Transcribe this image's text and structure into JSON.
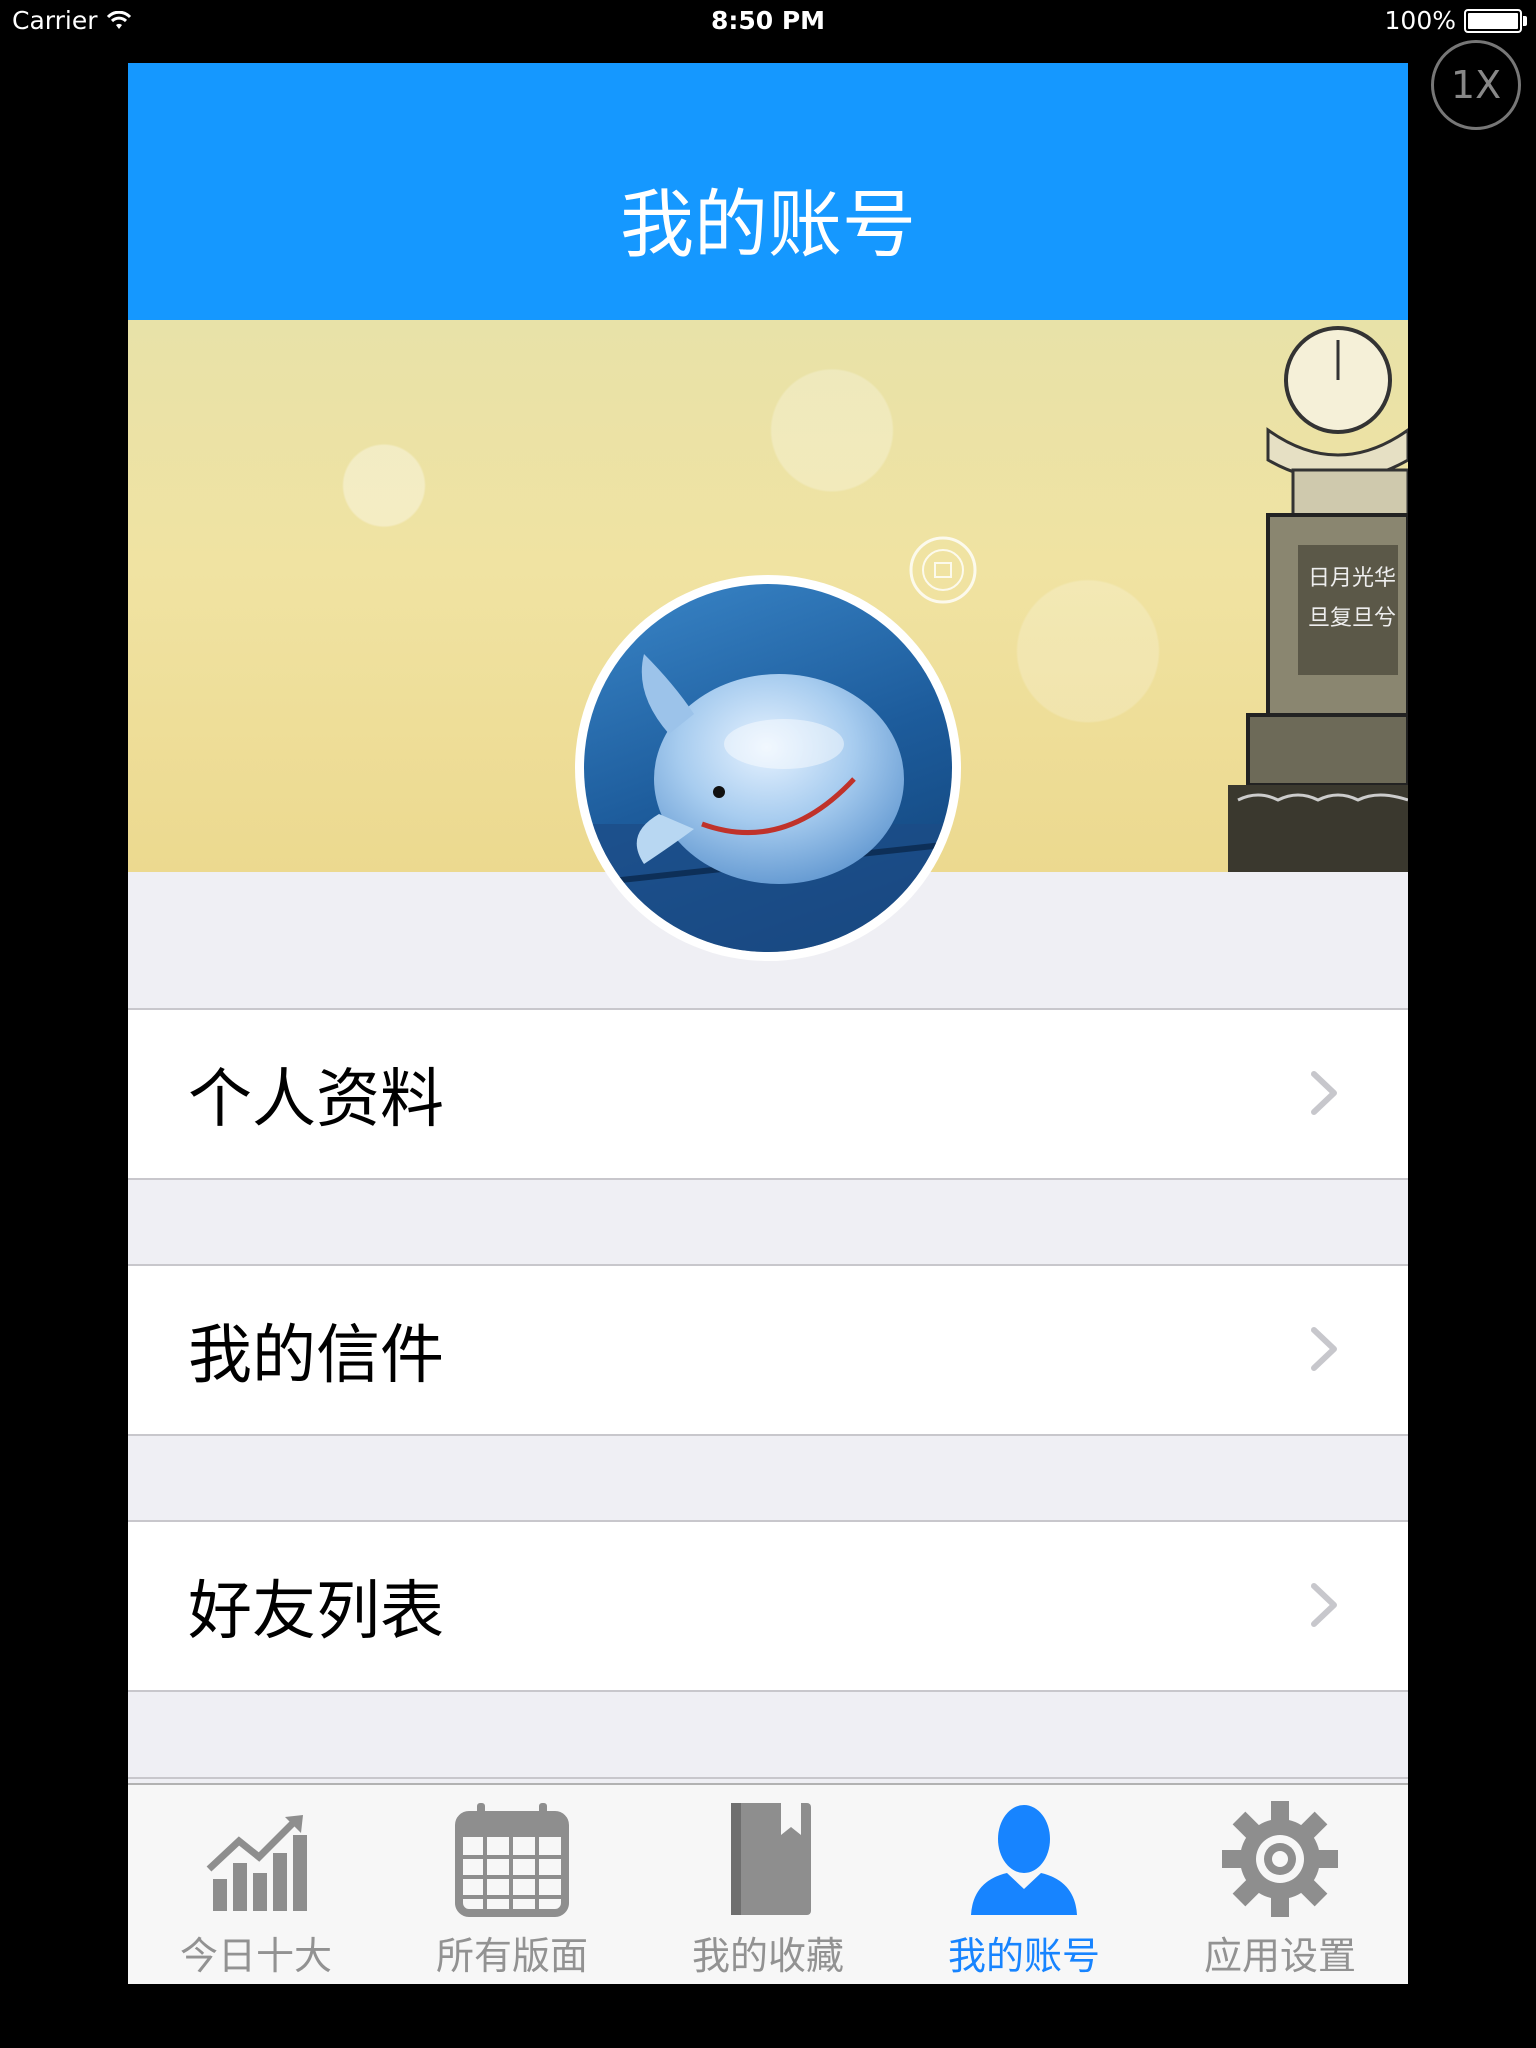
{
  "status_bar": {
    "carrier": "Carrier",
    "time": "8:50 PM",
    "battery": "100%",
    "battery_level": 1.0
  },
  "zoom_badge": "1X",
  "nav": {
    "title": "我的账号"
  },
  "menu": [
    {
      "label": "个人资料"
    },
    {
      "label": "我的信件"
    },
    {
      "label": "好友列表"
    }
  ],
  "tabs": [
    {
      "label": "今日十大",
      "icon": "chart-icon",
      "active": false
    },
    {
      "label": "所有版面",
      "icon": "calendar-icon",
      "active": false
    },
    {
      "label": "我的收藏",
      "icon": "bookmark-icon",
      "active": false
    },
    {
      "label": "我的账号",
      "icon": "person-icon",
      "active": true
    },
    {
      "label": "应用设置",
      "icon": "gear-icon",
      "active": false
    }
  ],
  "colors": {
    "accent": "#1598ff",
    "tab_active": "#1784ff",
    "tab_inactive": "#929292",
    "background": "#efeff4"
  }
}
